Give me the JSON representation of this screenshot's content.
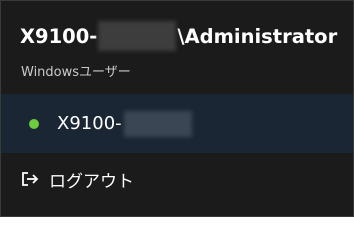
{
  "user": {
    "title_prefix": "X9100-",
    "title_suffix": "\\Administrator",
    "type_label": "Windowsユーザー"
  },
  "account": {
    "name_prefix": "X9100-",
    "status": "online",
    "status_color": "#6ccb3f"
  },
  "actions": {
    "logout_label": "ログアウト",
    "logout_icon": "sign-out-icon"
  },
  "theme": {
    "background": "#1b1b1b",
    "selected_row": "#1a2633",
    "text": "#ffffff"
  }
}
